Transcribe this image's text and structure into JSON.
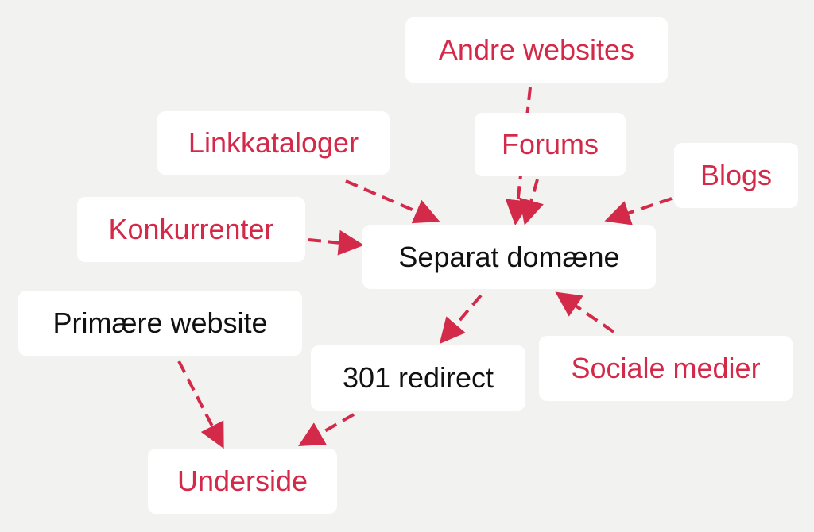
{
  "colors": {
    "accent": "#d42a4a",
    "background": "#f2f3f0",
    "node": "#ffffff"
  },
  "nodes": {
    "andre": "Andre websites",
    "linkkataloger": "Linkkataloger",
    "forums": "Forums",
    "blogs": "Blogs",
    "konkurrenter": "Konkurrenter",
    "separat": "Separat domæne",
    "primaere": "Primære website",
    "redirect": "301 redirect",
    "sociale": "Sociale medier",
    "underside": "Underside"
  },
  "edges": [
    [
      "Andre websites",
      "Separat domæne"
    ],
    [
      "Forums",
      "Separat domæne"
    ],
    [
      "Linkkataloger",
      "Separat domæne"
    ],
    [
      "Blogs",
      "Separat domæne"
    ],
    [
      "Konkurrenter",
      "Separat domæne"
    ],
    [
      "Sociale medier",
      "Separat domæne"
    ],
    [
      "Separat domæne",
      "301 redirect"
    ],
    [
      "301 redirect",
      "Underside"
    ],
    [
      "Primære website",
      "Underside"
    ]
  ]
}
